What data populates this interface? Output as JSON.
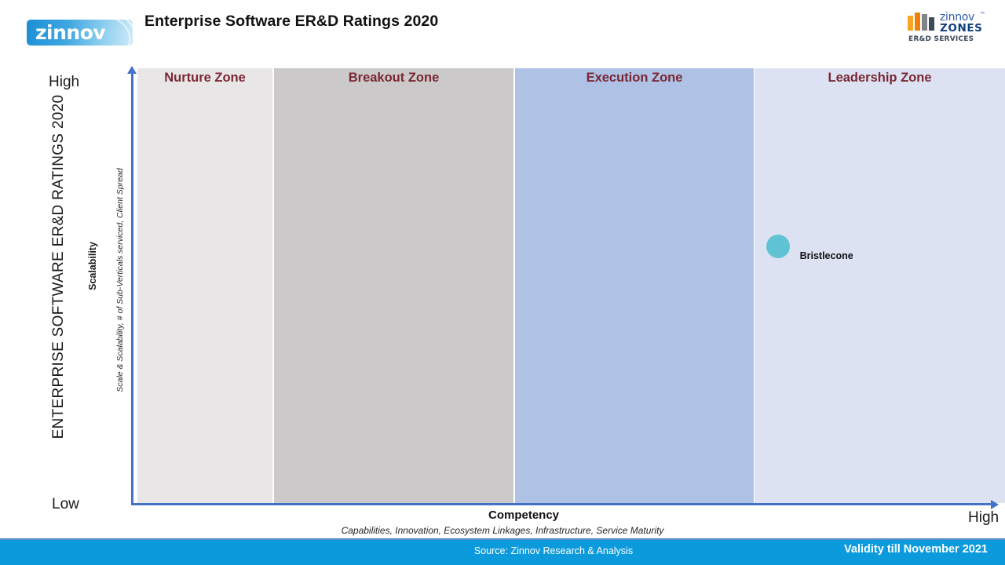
{
  "header": {
    "title": "Enterprise Software ER&D Ratings 2020",
    "logo_left": {
      "wordmark": "zinnov"
    },
    "logo_right": {
      "zinnov": "zinnov",
      "tm": "™",
      "zones": "ZONES",
      "service_line": "ER&D SERVICES"
    }
  },
  "axes": {
    "y_title": "ENTERPRISE SOFTWARE ER&D RATINGS 2020",
    "y_metric": "Scalability",
    "y_metric_detail": "Scale & Scalability, # of Sub-Verticals serviced, Client Spread",
    "y_high": "High",
    "y_low": "Low",
    "x_title": "Competency",
    "x_metric_detail": "Capabilities, Innovation, Ecosystem Linkages, Infrastructure, Service Maturity",
    "x_high": "High"
  },
  "zones": [
    {
      "id": "nurture",
      "label": "Nurture Zone",
      "color": "#E8E6E7"
    },
    {
      "id": "breakout",
      "label": "Breakout Zone",
      "color": "#CCC9CA"
    },
    {
      "id": "execution",
      "label": "Execution Zone",
      "color": "#AFC2E5"
    },
    {
      "id": "leadership",
      "label": "Leadership Zone",
      "color": "#DCE2F2"
    }
  ],
  "footer": {
    "source": "Source: Zinnov  Research & Analysis",
    "validity": "Validity till November 2021",
    "bar_color": "#0B9BDC"
  },
  "chart_data": {
    "type": "scatter",
    "title": "Enterprise Software ER&D Ratings 2020",
    "xlabel": "Competency",
    "ylabel": "Scalability",
    "xlim": [
      0,
      100
    ],
    "ylim": [
      0,
      100
    ],
    "grid": false,
    "legend": "none",
    "zone_bands": [
      {
        "name": "Nurture Zone",
        "x_range": [
          0,
          16
        ],
        "color": "#E8E6E7"
      },
      {
        "name": "Breakout Zone",
        "x_range": [
          16,
          44
        ],
        "color": "#CCC9CA"
      },
      {
        "name": "Execution Zone",
        "x_range": [
          44,
          72
        ],
        "color": "#AFC2E5"
      },
      {
        "name": "Leadership Zone",
        "x_range": [
          72,
          100
        ],
        "color": "#DCE2F2"
      }
    ],
    "points": [
      {
        "name": "Bristlecone",
        "zone": "Leadership Zone",
        "x": 74,
        "y": 59,
        "size": 30,
        "color": "#5FC3D4"
      }
    ]
  }
}
